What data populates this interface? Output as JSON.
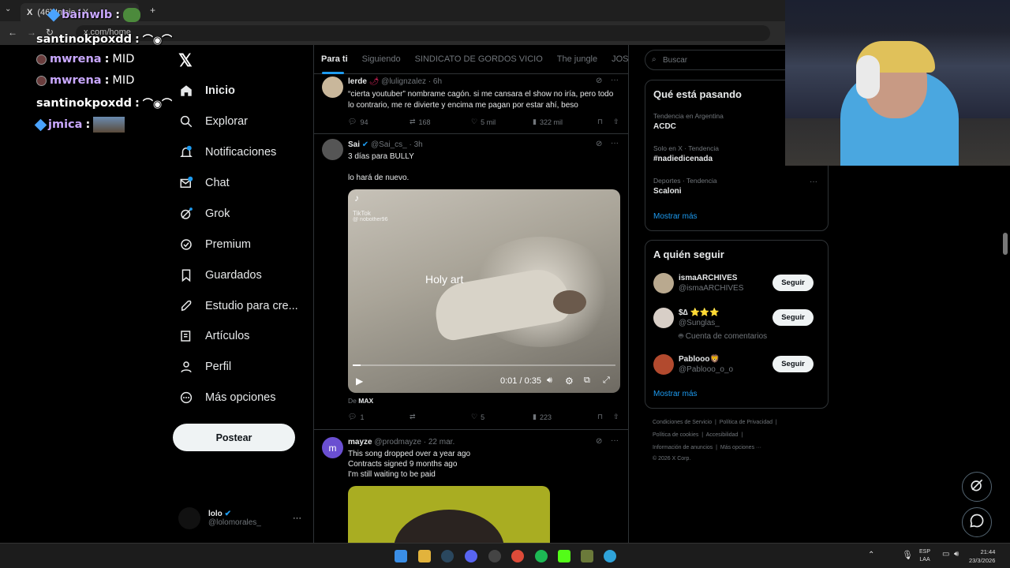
{
  "browser": {
    "tab_title": "(46) Inicio / X",
    "url": "x.com/home"
  },
  "chat": [
    {
      "user": "bainwlb",
      "sep": ":"
    },
    {
      "user": "santinokpoxdd",
      "sep": ":"
    },
    {
      "user": "mwrena",
      "sep": ":",
      "msg": "MID"
    },
    {
      "user": "mwrena",
      "sep": ":",
      "msg": "MID"
    },
    {
      "user": "santinokpoxdd",
      "sep": ":"
    },
    {
      "user": "jmica",
      "sep": ":"
    }
  ],
  "sidebar": {
    "items": [
      {
        "label": "Inicio",
        "icon": "home-icon"
      },
      {
        "label": "Explorar",
        "icon": "search-icon"
      },
      {
        "label": "Notificaciones",
        "icon": "bell-icon"
      },
      {
        "label": "Chat",
        "icon": "mail-icon"
      },
      {
        "label": "Grok",
        "icon": "grok-icon"
      },
      {
        "label": "Premium",
        "icon": "premium-icon"
      },
      {
        "label": "Guardados",
        "icon": "bookmark-icon"
      },
      {
        "label": "Estudio para cre...",
        "icon": "rocket-icon"
      },
      {
        "label": "Artículos",
        "icon": "article-icon"
      },
      {
        "label": "Perfil",
        "icon": "person-icon"
      },
      {
        "label": "Más opciones",
        "icon": "more-icon"
      }
    ],
    "post_label": "Postear",
    "account": {
      "name": "lolo",
      "handle": "@lolomorales_"
    }
  },
  "feed": {
    "tabs": [
      "Para ti",
      "Siguiendo",
      "SINDICATO DE GORDOS VICIO",
      "The jungle",
      "JOSEO"
    ],
    "tweets": [
      {
        "name": "lerde",
        "handle": "@lulignzalez",
        "time": "· 6h",
        "text": "“cierta youtuber” nombrame cagón. si me cansara el show no iría, pero todo lo contrario, me re divierte y encima me pagan por estar ahí, beso",
        "replies": "94",
        "reposts": "168",
        "likes": "5 mil",
        "views": "322 mil"
      },
      {
        "name": "Sai",
        "handle": "@Sai_cs_",
        "time": "· 3h",
        "text1": "3 días para BULLY",
        "text2": "lo hará de nuevo.",
        "video_overlay": "Holy art",
        "tiktok_label": "TikTok",
        "tiktok_user": "@ nobother96",
        "video_time": "0:01 / 0:35",
        "video_progress": 0.03,
        "source_prefix": "De",
        "source": "MAX",
        "replies": "1",
        "reposts": "",
        "likes": "5",
        "views": "223"
      },
      {
        "name": "mayze",
        "handle": "@prodmayze",
        "time": "· 22 mar.",
        "lines": [
          "This song dropped over a year ago",
          "Contracts signed 9 months ago",
          "I'm still waiting to be paid"
        ]
      }
    ]
  },
  "right": {
    "search_placeholder": "Buscar",
    "trends_title": "Qué está pasando",
    "trends": [
      {
        "ctx": "Tendencia en Argentina",
        "name": "ACDC"
      },
      {
        "ctx": "Solo en X · Tendencia",
        "name": "#nadiedicenada"
      },
      {
        "ctx": "Deportes · Tendencia",
        "name": "Scaloni"
      }
    ],
    "show_more": "Mostrar más",
    "follow_title": "A quién seguir",
    "follow": [
      {
        "name": "ismaARCHIVES",
        "handle": "@ismaARCHIVES",
        "extra": ""
      },
      {
        "name": "$∆ ⭐⭐⭐",
        "handle": "@Sunglas_",
        "extra": "Cuenta de comentarios"
      },
      {
        "name": "Pablooo🦁",
        "handle": "@Pablooo_o_o",
        "extra": ""
      }
    ],
    "follow_label": "Seguir",
    "footer": [
      "Condiciones de Servicio",
      "Política de Privacidad",
      "Política de cookies",
      "Accesibilidad",
      "Información de anuncios",
      "Más opciones ···",
      "© 2026 X Corp."
    ]
  },
  "taskbar": {
    "lang1": "ESP",
    "lang2": "LAA",
    "time": "21:44",
    "date": "23/3/2026"
  }
}
